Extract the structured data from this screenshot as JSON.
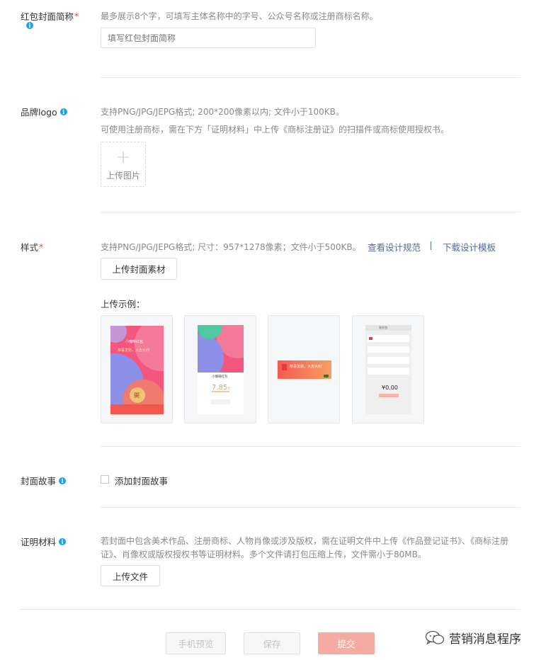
{
  "brief_name": {
    "label": "红包封面简称",
    "required_mark": "*",
    "hint": "最多展示8个字，可填写主体名称中的字号、公众号名称或注册商标名称。",
    "placeholder": "填写红包封面简称"
  },
  "brand_logo": {
    "label": "品牌logo",
    "hint_line1": "支持PNG/JPG/JEPG格式; 200*200像素以内; 文件小于100KB。",
    "hint_line2": "可使用注册商标，需在下方「证明材料」中上传《商标注册证》的扫描件或商标使用授权书。",
    "upload_plus": "+",
    "upload_label": "上传图片"
  },
  "style": {
    "label": "样式",
    "required_mark": "*",
    "hint": "支持PNG/JPG/JEPG格式; 尺寸：957*1278像素；文件小于500KB。",
    "link_spec": "查看设计规范",
    "link_template": "下载设计模板",
    "upload_button": "上传封面素材",
    "example_title": "上传示例：",
    "samples": {
      "s1": {
        "brand": "小咖啡红包",
        "greeting": "恭喜发财，大吉大利",
        "open": "開"
      },
      "s2": {
        "brand": "小咖啡红包",
        "amount": "7.85",
        "unit": "元"
      },
      "s3": {
        "greeting": "恭喜发财，大吉大利"
      },
      "s4": {
        "title": "发红包",
        "amount": "¥0.00"
      }
    }
  },
  "cover_story": {
    "label": "封面故事",
    "checkbox_label": "添加封面故事"
  },
  "proof": {
    "label": "证明材料",
    "hint": "若封面中包含美术作品、注册商标、人物肖像或涉及版权，需在证明文件中上传《作品登记证书》、《商标注册证》、肖像权或版权授权书等证明材料。多个文件请打包压缩上传，文件需小于80MB。",
    "upload_button": "上传文件"
  },
  "footer": {
    "preview": "手机预览",
    "save": "保存",
    "submit": "提交"
  },
  "watermark": {
    "text": "营销消息程序"
  },
  "colors": {
    "required": "#e64340",
    "info": "#1aa1f4",
    "link": "#576b95",
    "submit_disabled": "#f5aaa2"
  }
}
